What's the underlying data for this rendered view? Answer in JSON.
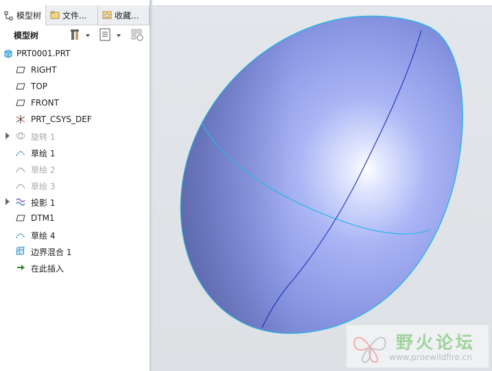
{
  "tabs": [
    {
      "label": "模型树",
      "icon": "model-tree-icon"
    },
    {
      "label": "文件...",
      "icon": "folder-icon"
    },
    {
      "label": "收藏...",
      "icon": "favorites-icon"
    }
  ],
  "toolbar": {
    "title": "模型树",
    "buttons": [
      "settings-icon",
      "show-list-icon",
      "filter-icon"
    ]
  },
  "tree": {
    "root": {
      "label": "PRT0001.PRT",
      "icon": "part-icon"
    },
    "items": [
      {
        "label": "RIGHT",
        "icon": "datum-plane-icon",
        "expandable": false,
        "disabled": false
      },
      {
        "label": "TOP",
        "icon": "datum-plane-icon",
        "expandable": false,
        "disabled": false
      },
      {
        "label": "FRONT",
        "icon": "datum-plane-icon",
        "expandable": false,
        "disabled": false
      },
      {
        "label": "PRT_CSYS_DEF",
        "icon": "coordinate-system-icon",
        "expandable": false,
        "disabled": false
      },
      {
        "label": "旋转 1",
        "icon": "revolve-icon",
        "expandable": true,
        "disabled": true
      },
      {
        "label": "草绘 1",
        "icon": "sketch-icon",
        "expandable": false,
        "disabled": false
      },
      {
        "label": "草绘 2",
        "icon": "sketch-icon",
        "expandable": false,
        "disabled": true
      },
      {
        "label": "草绘 3",
        "icon": "sketch-icon",
        "expandable": false,
        "disabled": true
      },
      {
        "label": "投影 1",
        "icon": "projected-curve-icon",
        "expandable": true,
        "disabled": false
      },
      {
        "label": "DTM1",
        "icon": "datum-plane-icon",
        "expandable": false,
        "disabled": false
      },
      {
        "label": "草绘 4",
        "icon": "sketch-icon",
        "expandable": false,
        "disabled": false
      },
      {
        "label": "边界混合 1",
        "icon": "boundary-blend-icon",
        "expandable": false,
        "disabled": false
      },
      {
        "label": "在此插入",
        "icon": "insert-here-arrow-icon",
        "expandable": false,
        "disabled": false
      }
    ]
  },
  "viewport": {
    "model": "egg-shaped-surface",
    "surface_color": "#9aa6f0",
    "edge_color": "#29b6e6"
  },
  "watermark": {
    "title": "野火论坛",
    "url": "www.proewildfire.cn"
  }
}
